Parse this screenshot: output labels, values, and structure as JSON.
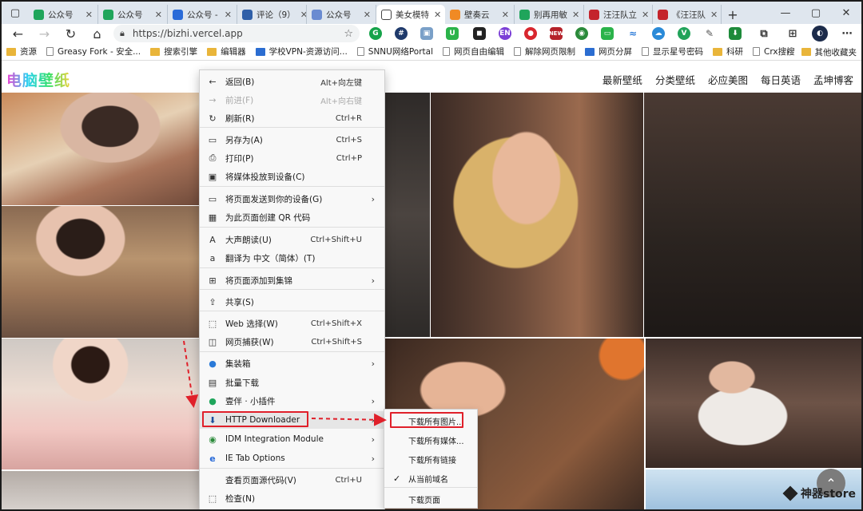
{
  "tabs": [
    {
      "label": "公众号",
      "color": "#1fa55b"
    },
    {
      "label": "公众号",
      "color": "#1fa55b"
    },
    {
      "label": "公众号 -",
      "color": "#2a6bd8"
    },
    {
      "label": "评论（9）",
      "color": "#2f5fa8"
    },
    {
      "label": "公众号",
      "color": "#6a8bd1"
    },
    {
      "label": "美女模特",
      "color": "#ffffff",
      "active": true
    },
    {
      "label": "壁奏云",
      "color": "#f08a24"
    },
    {
      "label": "别再用敏",
      "color": "#1fa55b"
    },
    {
      "label": "汪汪队立",
      "color": "#c4242c"
    },
    {
      "label": "《汪汪队",
      "color": "#c4242c"
    }
  ],
  "address": {
    "url": "https://bizhi.vercel.app"
  },
  "bookmarks": [
    {
      "label": "资源",
      "type": "folder"
    },
    {
      "label": "Greasy Fork - 安全...",
      "type": "page"
    },
    {
      "label": "搜索引擎",
      "type": "folder"
    },
    {
      "label": "编辑器",
      "type": "folder"
    },
    {
      "label": "学校VPN-资源访问...",
      "type": "blue"
    },
    {
      "label": "SNNU网络Portal",
      "type": "page"
    },
    {
      "label": "网页自由编辑",
      "type": "page"
    },
    {
      "label": "解除网页限制",
      "type": "page"
    },
    {
      "label": "网页分屏",
      "type": "blue"
    },
    {
      "label": "显示星号密码",
      "type": "page"
    },
    {
      "label": "科研",
      "type": "folder"
    },
    {
      "label": "Crx搜搜",
      "type": "page"
    }
  ],
  "bookmarks_other": "其他收藏夹",
  "site": {
    "logo": "电脑壁纸",
    "nav": [
      "最新壁纸",
      "分类壁纸",
      "必应美图",
      "每日英语",
      "孟坤博客"
    ]
  },
  "menu": [
    {
      "icon": "back-arrow-icon",
      "glyph": "←",
      "label": "返回(B)",
      "shortcut": "Alt+向左键"
    },
    {
      "icon": "forward-arrow-icon",
      "glyph": "→",
      "label": "前进(F)",
      "shortcut": "Alt+向右键",
      "disabled": true
    },
    {
      "icon": "refresh-icon",
      "glyph": "↻",
      "label": "刷新(R)",
      "shortcut": "Ctrl+R"
    },
    {
      "icon": "save-icon",
      "glyph": "▭",
      "label": "另存为(A)",
      "shortcut": "Ctrl+S"
    },
    {
      "icon": "print-icon",
      "glyph": "⎙",
      "label": "打印(P)",
      "shortcut": "Ctrl+P"
    },
    {
      "icon": "cast-icon",
      "glyph": "▣",
      "label": "将媒体投放到设备(C)",
      "shortcut": ""
    },
    {
      "icon": "send-to-device-icon",
      "glyph": "▭",
      "label": "将页面发送到你的设备(G)",
      "shortcut": "",
      "submenu": true
    },
    {
      "icon": "qr-code-icon",
      "glyph": "▦",
      "label": "为此页面创建 QR 代码",
      "shortcut": ""
    },
    {
      "icon": "read-aloud-icon",
      "glyph": "A",
      "label": "大声朗读(U)",
      "shortcut": "Ctrl+Shift+U"
    },
    {
      "icon": "translate-icon",
      "glyph": "a",
      "label": "翻译为 中文（简体）(T)",
      "shortcut": ""
    },
    {
      "icon": "collections-icon",
      "glyph": "⊞",
      "label": "将页面添加到集锦",
      "shortcut": "",
      "submenu": true
    },
    {
      "icon": "share-icon",
      "glyph": "⇪",
      "label": "共享(S)",
      "shortcut": ""
    },
    {
      "icon": "web-select-icon",
      "glyph": "⬚",
      "label": "Web 选择(W)",
      "shortcut": "Ctrl+Shift+X"
    },
    {
      "icon": "web-capture-icon",
      "glyph": "◫",
      "label": "网页捕获(W)",
      "shortcut": "Ctrl+Shift+S"
    },
    {
      "icon": "extension-icon",
      "glyph": "●",
      "label": "集装箱",
      "shortcut": "",
      "submenu": true
    },
    {
      "icon": "batch-download-icon",
      "glyph": "▤",
      "label": "批量下载",
      "shortcut": ""
    },
    {
      "icon": "plugin-icon",
      "glyph": "●",
      "label": "壹伴 · 小插件",
      "shortcut": "",
      "submenu": true
    },
    {
      "icon": "http-downloader-icon",
      "glyph": "⬇",
      "label": "HTTP Downloader",
      "shortcut": "",
      "submenu": true,
      "highlighted": true
    },
    {
      "icon": "idm-icon",
      "glyph": "◉",
      "label": "IDM Integration Module",
      "shortcut": "",
      "submenu": true
    },
    {
      "icon": "ie-tab-icon",
      "glyph": "e",
      "label": "IE Tab Options",
      "shortcut": "",
      "submenu": true
    },
    {
      "icon": "",
      "glyph": "",
      "label": "查看页面源代码(V)",
      "shortcut": "Ctrl+U"
    },
    {
      "icon": "inspect-icon",
      "glyph": "⬚",
      "label": "检查(N)",
      "shortcut": ""
    }
  ],
  "submenu": [
    {
      "label": "下载所有图片...",
      "checked": false,
      "highlighted": true
    },
    {
      "label": "下载所有媒体...",
      "checked": false
    },
    {
      "label": "下载所有链接",
      "checked": false
    },
    {
      "label": "从当前域名",
      "checked": true
    },
    {
      "label": "下载页面",
      "checked": false
    }
  ],
  "watermark": "神器store"
}
